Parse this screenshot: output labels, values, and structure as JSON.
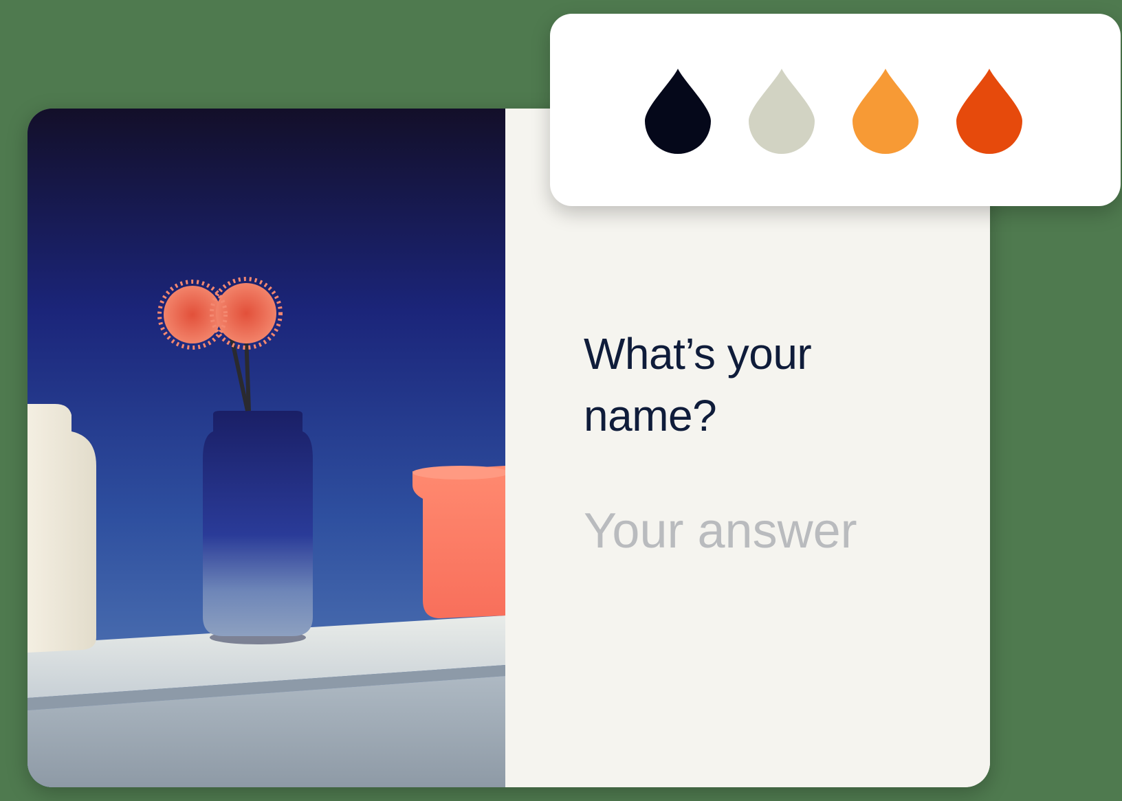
{
  "question": {
    "title": "What’s your name?",
    "answer_placeholder": "Your answer",
    "answer_value": ""
  },
  "palette": {
    "swatches": [
      {
        "name": "navy-black",
        "color": "#05081a",
        "icon": "droplet-icon"
      },
      {
        "name": "sage-gray",
        "color": "#d2d3c3",
        "icon": "droplet-icon"
      },
      {
        "name": "orange",
        "color": "#f79a35",
        "icon": "droplet-icon"
      },
      {
        "name": "red-orange",
        "color": "#e64a0c",
        "icon": "droplet-icon"
      }
    ]
  },
  "colors": {
    "background": "#4f7a4f",
    "card_background": "#f5f4ef",
    "title_text": "#0f1c3a",
    "placeholder_text": "#b9bbbe",
    "palette_background": "#ffffff"
  }
}
